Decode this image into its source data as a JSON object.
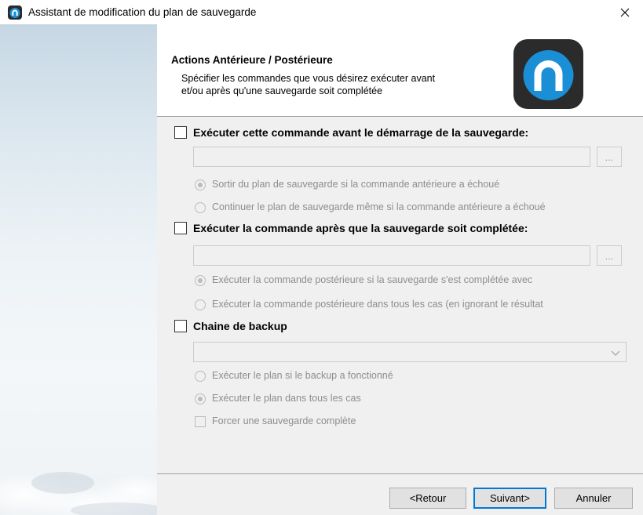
{
  "window": {
    "title": "Assistant de modification du plan de sauvegarde",
    "close_symbol": "✕"
  },
  "header": {
    "title": "Actions Antérieure / Postérieure",
    "description_line1": "Spécifier les commandes que vous désirez exécuter avant",
    "description_line2": "et/ou après qu'une sauvegarde soit complétée"
  },
  "pre_command": {
    "label": "Exécuter cette commande avant le démarrage de la sauvegarde:",
    "checked": false,
    "field_value": "",
    "browse_label": "...",
    "options": [
      {
        "label": "Sortir du plan de sauvegarde si la commande antérieure a échoué",
        "selected": true
      },
      {
        "label": "Continuer le plan de sauvegarde même si la commande antérieure a échoué",
        "selected": false
      }
    ]
  },
  "post_command": {
    "label": "Exécuter la commande après que la sauvegarde soit complétée:",
    "checked": false,
    "field_value": "",
    "browse_label": "...",
    "options": [
      {
        "label": "Exécuter la commande postérieure si la sauvegarde s'est complétée avec",
        "selected": true
      },
      {
        "label": "Exécuter la commande postérieure dans tous les cas (en ignorant le résultat",
        "selected": false
      }
    ]
  },
  "backup_chain": {
    "label": "Chaine de backup",
    "checked": false,
    "selected_value": "",
    "options": [
      {
        "label": "Exécuter le plan si le backup a fonctionné",
        "selected": false
      },
      {
        "label": "Exécuter le plan dans tous les cas",
        "selected": true
      }
    ],
    "force_full_label": "Forcer une sauvegarde complète",
    "force_full_checked": false
  },
  "footer": {
    "back_label": "<Retour",
    "next_label": "Suivant>",
    "cancel_label": "Annuler"
  },
  "colors": {
    "brand": "#1a8fd6",
    "logo_bg": "#2b2b2b",
    "accent": "#0078d7",
    "disabled_text": "#8d8d8d"
  }
}
